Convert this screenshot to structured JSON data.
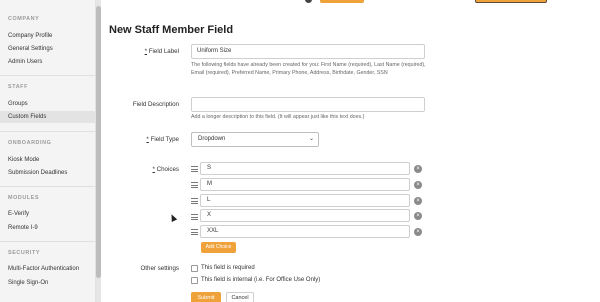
{
  "sidebar": {
    "sections": [
      {
        "head": "COMPANY",
        "items": [
          "Company Profile",
          "General Settings",
          "Admin Users"
        ]
      },
      {
        "head": "STAFF",
        "items": [
          "Groups",
          "Custom Fields"
        ]
      },
      {
        "head": "ONBOARDING",
        "items": [
          "Kiosk Mode",
          "Submission Deadlines"
        ]
      },
      {
        "head": "MODULES",
        "items": [
          "E-Verify",
          "Remote I-9"
        ]
      },
      {
        "head": "SECURITY",
        "items": [
          "Multi-Factor Authentication",
          "Single Sign-On"
        ]
      }
    ],
    "active_item": "Custom Fields"
  },
  "main": {
    "title": "New Staff Member Field",
    "field_label": {
      "required_mark": "*",
      "label": " Field Label",
      "value": "Uniform Size",
      "help": "The following fields have already been created for you: First Name (required), Last Name (required), Email (required), Preferred Name, Primary Phone, Address, Birthdate, Gender, SSN"
    },
    "field_description": {
      "label": "Field Description",
      "value": "",
      "help": "Add a longer description to this field. (It will appear just like this text does.)"
    },
    "field_type": {
      "required_mark": "*",
      "label": " Field Type",
      "value": "Dropdown"
    },
    "choices": {
      "required_mark": "*",
      "label": " Choices",
      "items": [
        "S",
        "M",
        "L",
        "X",
        "XXL"
      ],
      "add_label": "Add Choice"
    },
    "other_settings": {
      "label": "Other settings",
      "options": [
        {
          "label": "This field is required",
          "checked": false
        },
        {
          "label": "This field is internal (i.e. For Office Use Only)",
          "checked": false
        }
      ]
    },
    "submit_label": "Submit",
    "cancel_label": "Cancel"
  },
  "colors": {
    "accent": "#f0a23a",
    "sidebar_bg": "#f4f4f4",
    "active_bg": "#e3e3e3"
  },
  "icons": {
    "drag": "drag-handle-icon",
    "remove": "remove-circle-icon",
    "dropdown": "chevron-down-icon"
  }
}
